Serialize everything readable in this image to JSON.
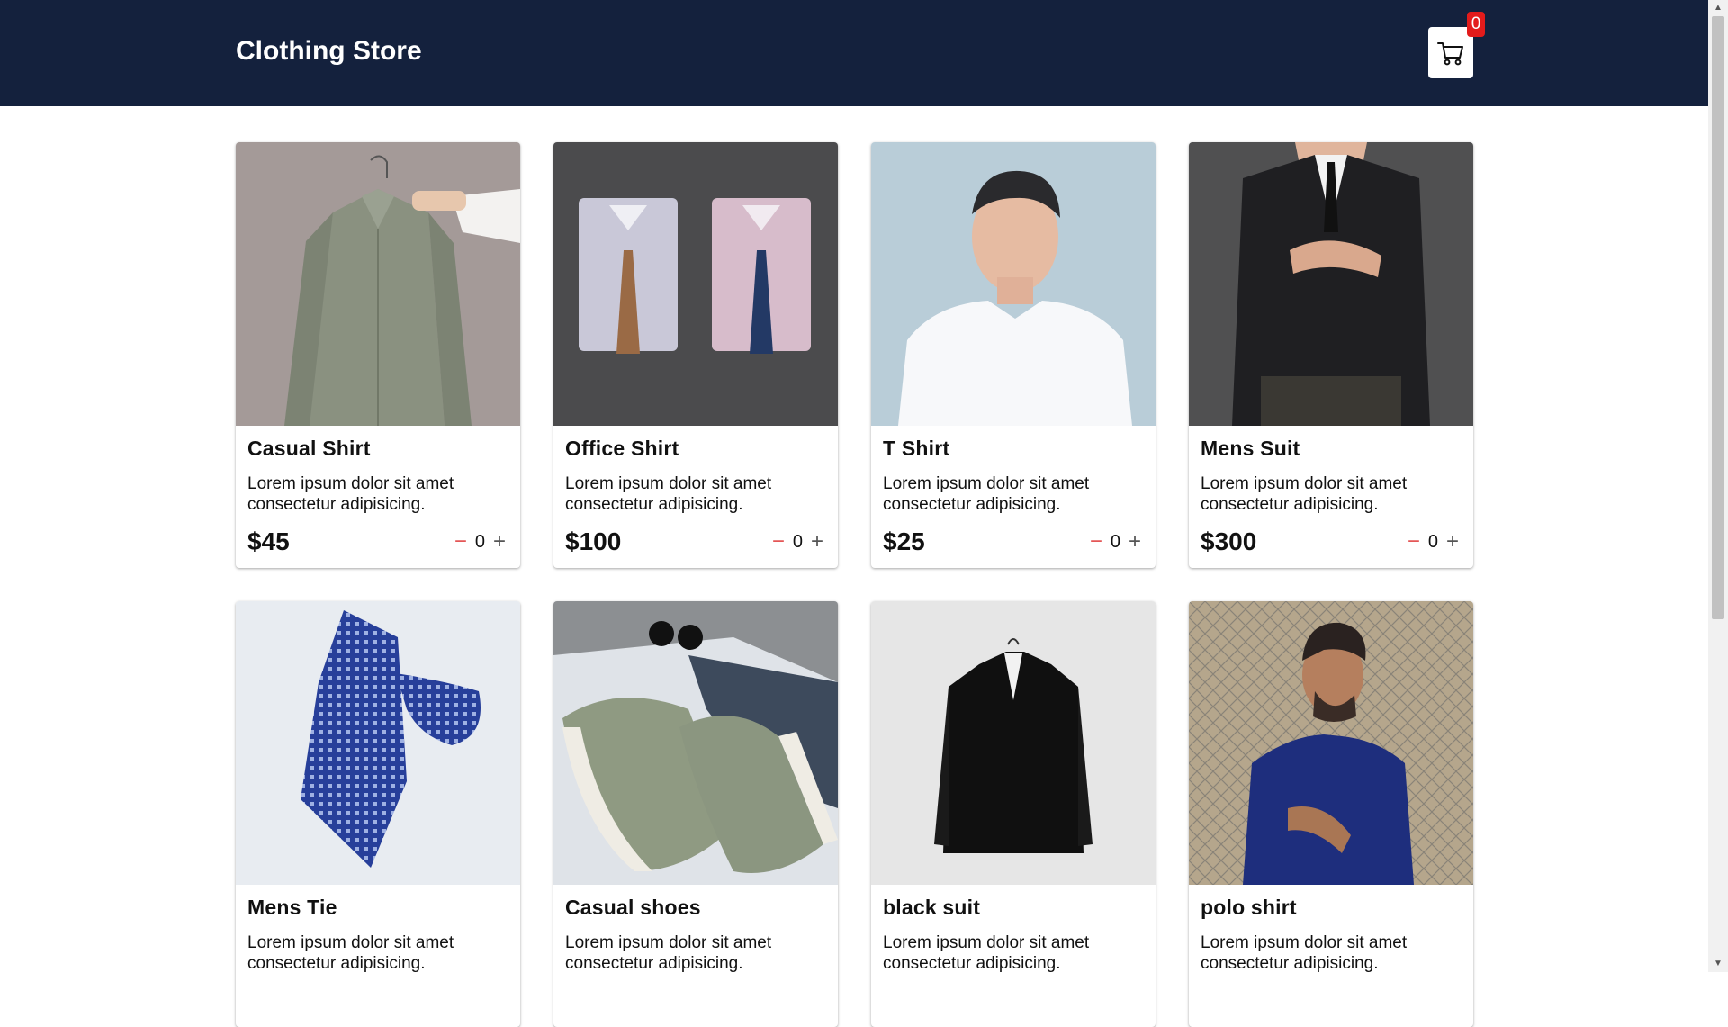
{
  "header": {
    "title": "Clothing Store",
    "cart_count": "0",
    "cart_icon": "cart-icon"
  },
  "products": [
    {
      "name": "Casual Shirt",
      "desc": "Lorem ipsum dolor sit amet consectetur adipisicing.",
      "price": "$45",
      "qty": "0"
    },
    {
      "name": "Office Shirt",
      "desc": "Lorem ipsum dolor sit amet consectetur adipisicing.",
      "price": "$100",
      "qty": "0"
    },
    {
      "name": "T Shirt",
      "desc": "Lorem ipsum dolor sit amet consectetur adipisicing.",
      "price": "$25",
      "qty": "0"
    },
    {
      "name": "Mens Suit",
      "desc": "Lorem ipsum dolor sit amet consectetur adipisicing.",
      "price": "$300",
      "qty": "0"
    },
    {
      "name": "Mens Tie",
      "desc": "Lorem ipsum dolor sit amet consectetur adipisicing.",
      "price": "",
      "qty": ""
    },
    {
      "name": "Casual shoes",
      "desc": "Lorem ipsum dolor sit amet consectetur adipisicing.",
      "price": "",
      "qty": ""
    },
    {
      "name": "black suit",
      "desc": "Lorem ipsum dolor sit amet consectetur adipisicing.",
      "price": "",
      "qty": ""
    },
    {
      "name": "polo shirt",
      "desc": "Lorem ipsum dolor sit amet consectetur adipisicing.",
      "price": "",
      "qty": ""
    }
  ],
  "controls": {
    "minus_icon": "minus-icon",
    "plus_icon": "plus-icon"
  },
  "colors": {
    "header_bg": "#14213d",
    "badge": "#e31b1b",
    "minus": "#e35353"
  }
}
